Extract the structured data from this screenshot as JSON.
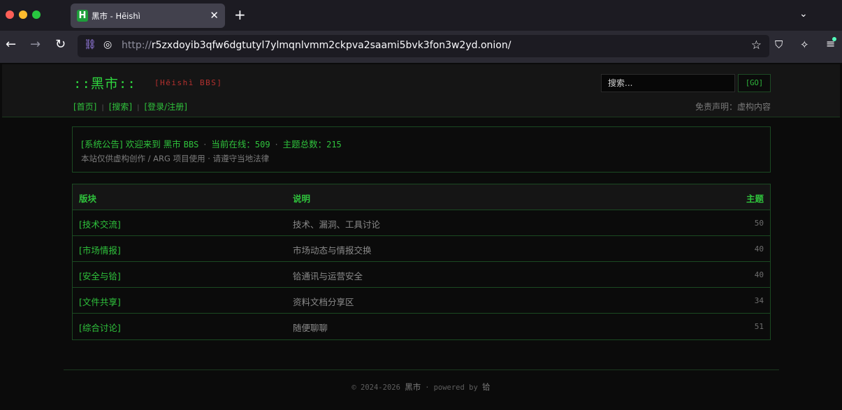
{
  "browser": {
    "tab_title": "黑市 - Hēishì",
    "tab_favicon": "H",
    "url_scheme": "http://",
    "url_host": "r5zxdoyib3qfw6dgtutyl7ylmqnlvmm2ckpva2saami5bvk3fon3w2yd.onion/"
  },
  "header": {
    "logo": "::黑市::",
    "logo_sub": "[Hēishì BBS]",
    "search_placeholder": "搜索...",
    "go_label": "[GO]",
    "nav": [
      "[首页]",
      "[搜索]",
      "[登录/注册]"
    ],
    "nav_sep": "|",
    "disclaimer": "免责声明：虚构内容"
  },
  "notice": {
    "tag": "[系统公告]",
    "welcome": "欢迎来到 黑市",
    "bbs": "BBS",
    "online_label": "当前在线：",
    "online_value": "509",
    "topics_label": "主题总数：",
    "topics_value": "215",
    "sub": "本站仅供虚构创作 / ARG 项目使用 · 请遵守当地法律"
  },
  "table": {
    "headers": {
      "board": "版块",
      "desc": "说明",
      "count": "主题"
    },
    "rows": [
      {
        "board": "[技术交流]",
        "desc": "技术、漏洞、工具讨论",
        "count": "50"
      },
      {
        "board": "[市场情报]",
        "desc": "市场动态与情报交换",
        "count": "40"
      },
      {
        "board": "[安全与铪]",
        "desc": "铪通讯与运营安全",
        "count": "40"
      },
      {
        "board": "[文件共享]",
        "desc": "资料文档分享区",
        "count": "34"
      },
      {
        "board": "[综合讨论]",
        "desc": "随便聊聊",
        "count": "51"
      }
    ]
  },
  "footer": {
    "years": "© 2024-2026",
    "name": "黑市",
    "powered": "powered by",
    "by": "铪"
  }
}
